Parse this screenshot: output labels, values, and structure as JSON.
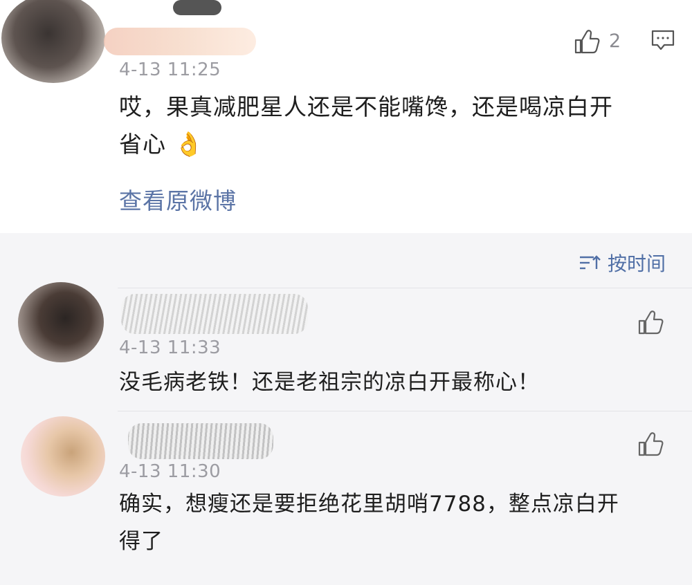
{
  "main_post": {
    "time": "4-13 11:25",
    "like_count": "2",
    "text_line1": "哎，果真减肥星人还是不能嘴馋，还是喝凉白开",
    "text_line2": "省心",
    "emoji": "👌",
    "view_original": "查看原微博"
  },
  "sort": {
    "label": "按时间"
  },
  "comments": [
    {
      "time": "4-13 11:33",
      "text": "没毛病老铁！还是老祖宗的凉白开最称心！"
    },
    {
      "time": "4-13 11:30",
      "text_line1": "确实，想瘦还是要拒绝花里胡哨7788，整点凉白开",
      "text_line2": "得了"
    }
  ],
  "colors": {
    "link_blue": "#5b74a6",
    "sort_blue": "#506fa6",
    "timestamp_gray": "#9c9ca2",
    "card_bg": "#ffffff",
    "list_bg": "#f5f5f7"
  }
}
